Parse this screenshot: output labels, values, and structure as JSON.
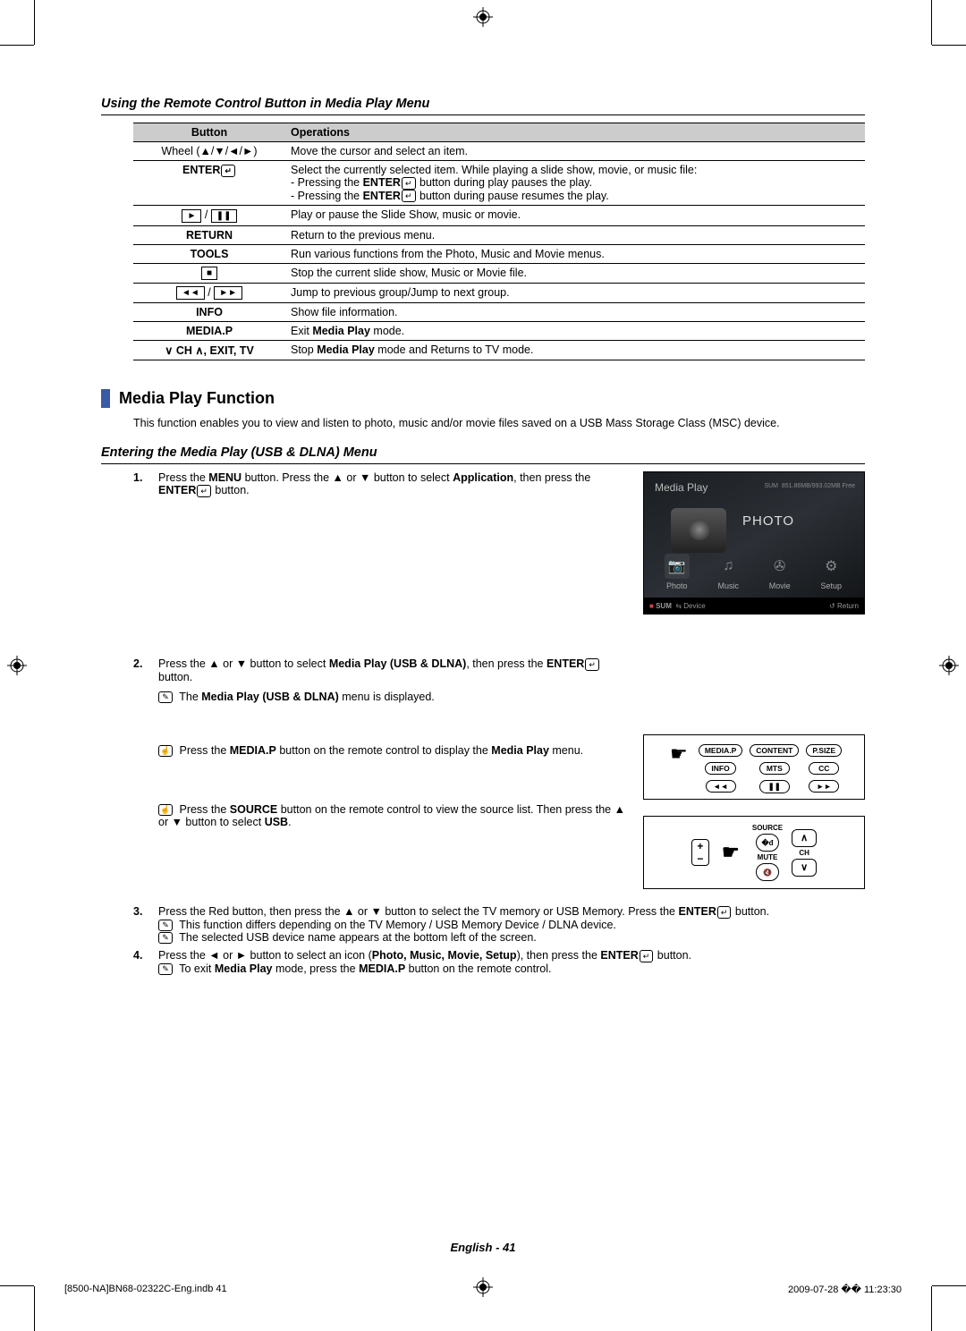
{
  "section1": {
    "title": "Using the Remote Control Button in Media Play Menu",
    "col_button": "Button",
    "col_ops": "Operations",
    "rows": [
      {
        "btn": "Wheel (▲/▼/◄/►)",
        "op": "Move the cursor and select an item."
      },
      {
        "btn": "ENTER",
        "btn_icon": "↵",
        "op": "Select the currently selected item. While playing a slide show, movie, or music file:\n- Pressing the ENTER ↵ button during play pauses the play.\n- Pressing the ENTER ↵ button during pause resumes the play."
      },
      {
        "btn_sym": "► / ❚❚",
        "op": "Play or pause the Slide Show, music or movie."
      },
      {
        "btn": "RETURN",
        "op": "Return to the previous menu."
      },
      {
        "btn": "TOOLS",
        "op": "Run various functions from the Photo, Music and Movie menus."
      },
      {
        "btn_sym": "■",
        "op": "Stop the current slide show, Music or Movie file."
      },
      {
        "btn_sym": "◄◄ / ►►",
        "op": "Jump to previous group/Jump to next group."
      },
      {
        "btn": "INFO",
        "op": "Show file information."
      },
      {
        "btn": "MEDIA.P",
        "op": "Exit Media Play mode.",
        "op_bold1": "Media Play"
      },
      {
        "btn": "∨ CH ∧, EXIT, TV",
        "op": "Stop Media Play mode and Returns to TV mode.",
        "op_bold1": "Media Play"
      }
    ]
  },
  "section2": {
    "title": "Media Play Function",
    "desc": "This function enables you to view and listen to photo, music and/or movie files saved on a USB Mass Storage Class (MSC) device."
  },
  "section3": {
    "title": "Entering the Media Play (USB & DLNA) Menu",
    "step1": {
      "num": "1.",
      "text_a": "Press the ",
      "b1": "MENU",
      "text_b": " button. Press the ▲ or ▼ button to select ",
      "b2": "Application",
      "text_c": ", then press the ",
      "b3": "ENTER",
      "enter_icon": "↵",
      "text_d": " button."
    },
    "step2": {
      "num": "2.",
      "line1_a": "Press the ▲ or ▼ button to select ",
      "line1_b": "Media Play (USB & DLNA)",
      "line1_c": ", then press the ",
      "line1_d": "ENTER",
      "enter_icon": "↵",
      "line1_e": " button.",
      "note1_a": "The ",
      "note1_b": "Media Play (USB & DLNA)",
      "note1_c": " menu is displayed.",
      "tip1_a": "Press the ",
      "tip1_b": "MEDIA.P",
      "tip1_c": " button on the remote control to display the ",
      "tip1_d": "Media Play",
      "tip1_e": " menu.",
      "tip2_a": "Press the ",
      "tip2_b": "SOURCE",
      "tip2_c": " button on the remote control to view the source list. Then press the ▲ or ▼ button to select ",
      "tip2_d": "USB",
      "tip2_e": "."
    },
    "step3": {
      "num": "3.",
      "a": "Press the Red button, then press the ▲ or ▼ button to select the TV memory or USB Memory. Press the ",
      "b": "ENTER",
      "enter_icon": "↵",
      "c": " button.",
      "note1": "This function differs depending on the TV Memory / USB Memory Device / DLNA device.",
      "note2": "The selected USB device name appears at the bottom left of the screen."
    },
    "step4": {
      "num": "4.",
      "a": "Press the ◄ or ► button to select an icon (",
      "b": "Photo, Music, Movie, Setup",
      "c": "), then press the ",
      "d": "ENTER",
      "enter_icon": "↵",
      "e": " button.",
      "note1_a": "To exit ",
      "note1_b": "Media Play",
      "note1_c": " mode, press the ",
      "note1_d": "MEDIA.P",
      "note1_e": " button on the remote control."
    }
  },
  "tv": {
    "title": "Media Play",
    "sum_top_1": "SUM",
    "sum_top_2": "851.86MB/993.02MB Free",
    "big_label": "PHOTO",
    "icons": {
      "photo": "Photo",
      "music": "Music",
      "movie": "Movie",
      "setup": "Setup"
    },
    "bottom_left_a": "SUM",
    "bottom_left_b": "Device",
    "bottom_right": "Return"
  },
  "remote1": {
    "mediap": "MEDIA.P",
    "content": "CONTENT",
    "psize": "P.SIZE",
    "info": "INFO",
    "mts": "MTS",
    "cc": "CC",
    "rew": "◄◄",
    "pause": "❚❚",
    "ff": "►►"
  },
  "remote2": {
    "source": "SOURCE",
    "ch": "CH",
    "mute": "MUTE"
  },
  "footer_page": "English - 41",
  "print_footer_left": "[8500-NA]BN68-02322C-Eng.indb   41",
  "print_footer_right": "2009-07-28   �� 11:23:30"
}
